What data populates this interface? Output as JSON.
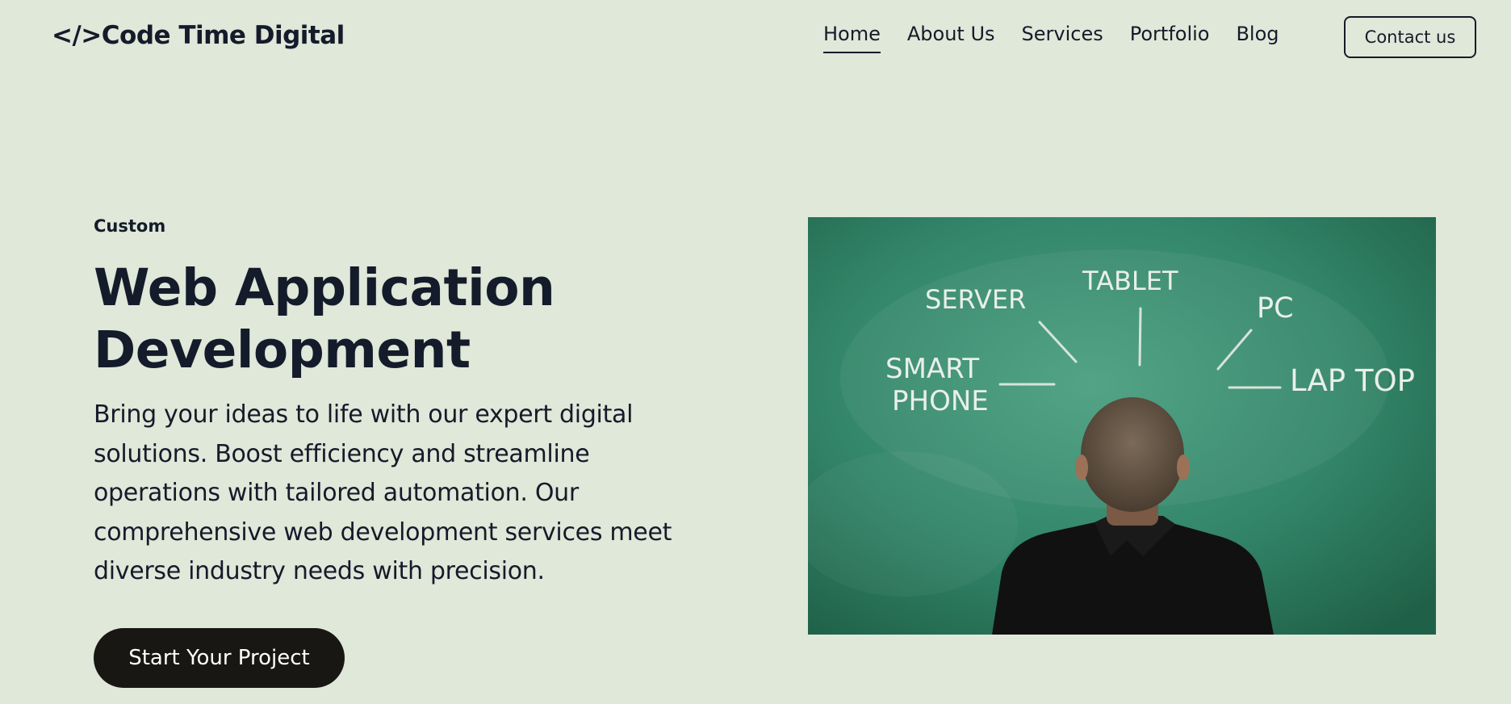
{
  "header": {
    "logo": "</>Code Time Digital",
    "nav": [
      {
        "label": "Home",
        "active": true
      },
      {
        "label": "About Us",
        "active": false
      },
      {
        "label": "Services",
        "active": false
      },
      {
        "label": "Portfolio",
        "active": false
      },
      {
        "label": "Blog",
        "active": false
      }
    ],
    "contact_label": "Contact us"
  },
  "hero": {
    "eyebrow": "Custom",
    "title": "Web Application Development",
    "description": "Bring your ideas to life with our expert digital solutions. Boost efficiency and streamline operations with tailored automation. Our comprehensive web development services meet diverse industry needs with precision.",
    "cta_label": "Start Your Project",
    "image": {
      "chalk_labels": {
        "server": "SERVER",
        "tablet": "TABLET",
        "pc": "PC",
        "smart": "SMART",
        "phone": "PHONE",
        "laptop": "LAP TOP"
      }
    }
  },
  "colors": {
    "background": "#dfe8d9",
    "text": "#141b2a",
    "cta_background": "#181714",
    "chalkboard": "#2f8567"
  }
}
